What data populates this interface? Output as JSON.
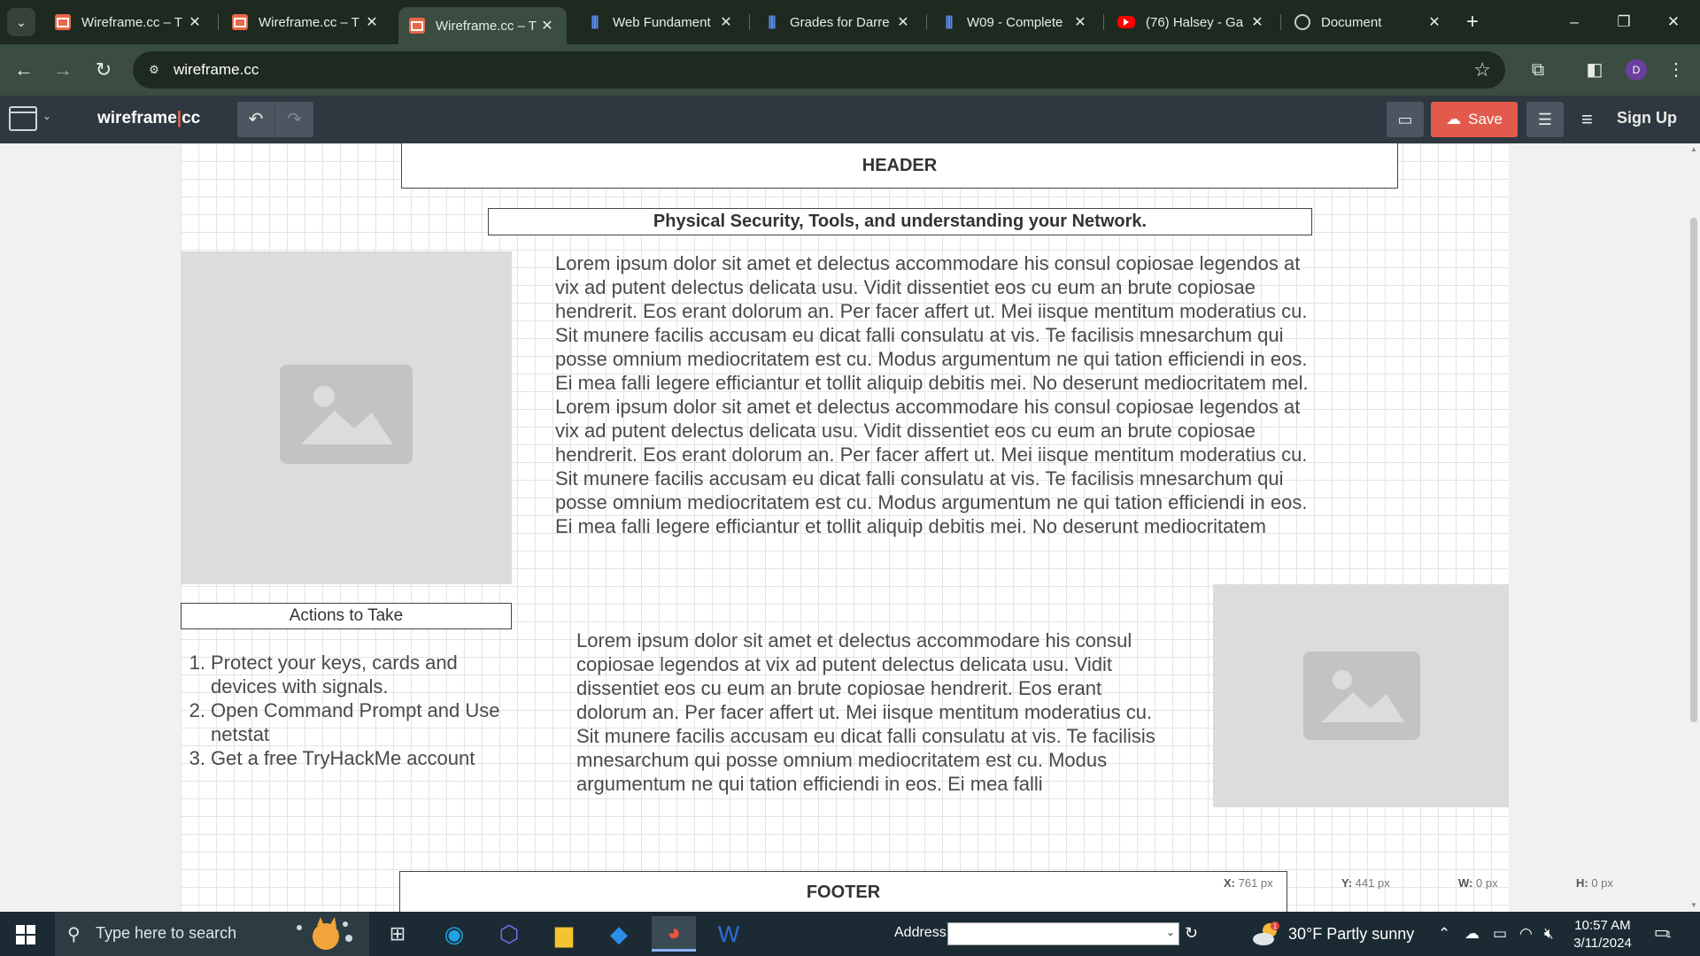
{
  "browser": {
    "tabs": [
      {
        "title": "Wireframe.cc – T",
        "favicon": "wireframe-icon",
        "active": false
      },
      {
        "title": "Wireframe.cc – T",
        "favicon": "wireframe-icon",
        "active": false
      },
      {
        "title": "Wireframe.cc – T",
        "favicon": "wireframe-icon",
        "active": true
      },
      {
        "title": "Web Fundament",
        "favicon": "canvas-bars-icon",
        "active": false
      },
      {
        "title": "Grades for Darre",
        "favicon": "canvas-bars-icon",
        "active": false
      },
      {
        "title": "W09 - Complete",
        "favicon": "canvas-bars-icon",
        "active": false
      },
      {
        "title": "(76) Halsey - Ga",
        "favicon": "youtube-icon",
        "active": false
      },
      {
        "title": "Document",
        "favicon": "globe-icon",
        "active": false
      }
    ],
    "url": "wireframe.cc",
    "profile_initial": "D",
    "colors": {
      "frame": "#1e2a1f",
      "toolbar": "#3a4d40"
    }
  },
  "app": {
    "brand_left": "wireframe",
    "brand_sep": "|",
    "brand_right": "cc",
    "save_label": "Save",
    "signup_label": "Sign Up",
    "colors": {
      "appbar": "#2f3840",
      "save": "#e25a4b"
    }
  },
  "wireframe": {
    "header": "HEADER",
    "subtitle": "Physical Security, Tools, and understanding your Network.",
    "paragraph1": "Lorem ipsum dolor sit amet et delectus accommodare his consul copiosae legendos at vix ad putent delectus delicata usu. Vidit dissentiet eos cu eum an brute copiosae hendrerit. Eos erant dolorum an. Per facer affert ut. Mei iisque mentitum moderatius cu. Sit munere facilis accusam eu dicat falli consulatu at vis. Te facilisis mnesarchum qui posse omnium mediocritatem est cu. Modus argumentum ne qui tation efficiendi in eos. Ei mea falli legere efficiantur et tollit aliquip debitis mei. No deserunt mediocritatem mel. Lorem ipsum dolor sit amet et delectus accommodare his consul copiosae legendos at vix ad putent delectus delicata usu. Vidit dissentiet eos cu eum an brute copiosae hendrerit. Eos erant dolorum an. Per facer affert ut. Mei iisque mentitum moderatius cu. Sit munere facilis accusam eu dicat falli consulatu at vis. Te facilisis mnesarchum qui posse omnium mediocritatem est cu. Modus argumentum ne qui tation efficiendi in eos. Ei mea falli legere efficiantur et tollit aliquip debitis mei. No deserunt mediocritatem",
    "actions_title": "Actions to Take",
    "actions": [
      {
        "num": "1.",
        "text": "Protect your keys, cards and devices with signals."
      },
      {
        "num": "2.",
        "text": "Open Command Prompt and Use netstat"
      },
      {
        "num": "3.",
        "text": "Get a free TryHackMe account"
      }
    ],
    "paragraph2": "Lorem ipsum dolor sit amet et delectus accommodare his consul copiosae legendos at vix ad putent delectus delicata usu. Vidit dissentiet eos cu eum an brute copiosae hendrerit. Eos erant dolorum an. Per facer affert ut. Mei iisque mentitum moderatius cu. Sit munere facilis accusam eu dicat falli consulatu at vis. Te facilisis mnesarchum qui posse omnium mediocritatem est cu. Modus argumentum ne qui tation efficiendi in eos. Ei mea falli",
    "footer": "FOOTER"
  },
  "status": {
    "x_label": "X:",
    "x_value": "761 px",
    "y_label": "Y:",
    "y_value": "441 px",
    "w_label": "W:",
    "w_value": "0 px",
    "h_label": "H:",
    "h_value": "0 px"
  },
  "taskbar": {
    "search_placeholder": "Type here to search",
    "address_label": "Address",
    "weather": "30°F  Partly sunny",
    "weather_badge": "1",
    "time": "10:57 AM",
    "date": "3/11/2024",
    "notification_count": "1"
  }
}
